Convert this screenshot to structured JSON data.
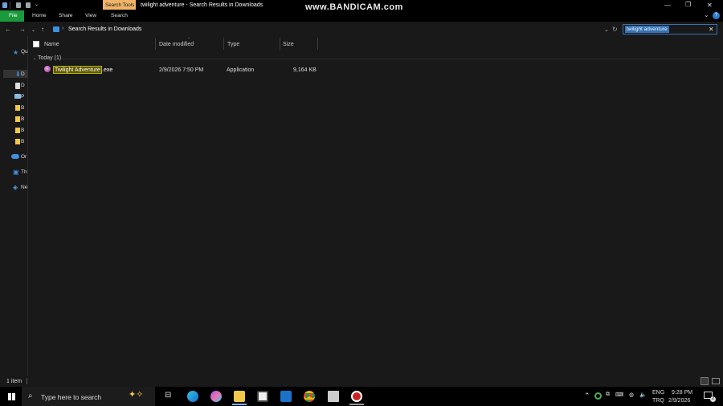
{
  "window": {
    "title": "twilight adventure - Search Results in Downloads",
    "watermark": "www.BANDICAM.com",
    "context_tab": "Search Tools"
  },
  "ribbon": {
    "tabs": [
      "File",
      "Home",
      "Share",
      "View",
      "Search"
    ]
  },
  "address": {
    "path": "Search Results in Downloads",
    "search_query": "twilight adventure"
  },
  "nav_pane": {
    "items": [
      "Qu",
      "D",
      "D",
      "P",
      "B",
      "B",
      "B",
      "B",
      "Or",
      "Th",
      "Ne"
    ]
  },
  "columns": {
    "name": "Name",
    "date_modified": "Date modified",
    "type": "Type",
    "size": "Size"
  },
  "group": {
    "label": "Today (1)"
  },
  "file": {
    "name_highlight": "Twilight Adventure",
    "name_rest": ".exe",
    "date_modified": "2/9/2026 7:50 PM",
    "type": "Application",
    "size": "9,164 KB"
  },
  "status": {
    "count": "1 item"
  },
  "taskbar": {
    "search_placeholder": "Type here to search",
    "lang": "ENG",
    "locale": "TRQ",
    "time": "9:28 PM",
    "date": "2/9/2026",
    "notifications": "2"
  },
  "colors": {
    "file_tab": "#1a9a3c",
    "search_tools": "#f0b46a",
    "match_highlight": "#5c5600",
    "selection": "#3a6fb5"
  }
}
